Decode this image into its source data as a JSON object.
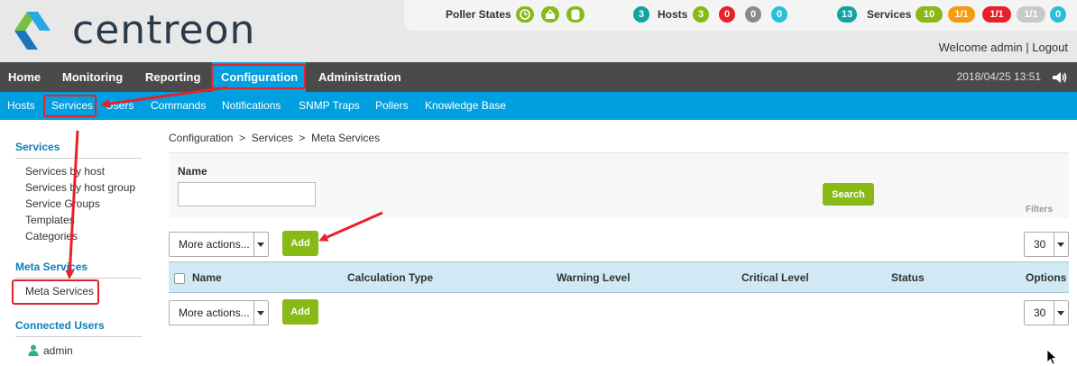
{
  "brand": {
    "name": "centreon"
  },
  "status_bar": {
    "poller_label": "Poller States",
    "hosts_count": "3",
    "hosts_label": "Hosts",
    "hosts_states": [
      "3",
      "0",
      "0",
      "0"
    ],
    "services_count": "13",
    "services_label": "Services",
    "services_states": [
      "10",
      "1/1",
      "1/1",
      "1/1",
      "0"
    ]
  },
  "user": {
    "welcome": "Welcome admin",
    "separator": "|",
    "logout": "Logout"
  },
  "main_nav": [
    "Home",
    "Monitoring",
    "Reporting",
    "Configuration",
    "Administration"
  ],
  "datetime": "2018/04/25 13:51",
  "sub_nav": [
    "Hosts",
    "Services",
    "Users",
    "Commands",
    "Notifications",
    "SNMP Traps",
    "Pollers",
    "Knowledge Base"
  ],
  "sidebar": {
    "services_title": "Services",
    "services_items": [
      "Services by host",
      "Services by host group",
      "Service Groups",
      "Templates",
      "Categories"
    ],
    "meta_title": "Meta Services",
    "meta_items": [
      "Meta Services"
    ],
    "connected_title": "Connected Users",
    "connected_users": [
      "admin"
    ]
  },
  "breadcrumb": "Configuration  >  Services  >  Meta Services",
  "filter": {
    "name_label": "Name",
    "name_value": "",
    "search_label": "Search",
    "filters_label": "Filters"
  },
  "toolbar": {
    "more_actions": "More actions...",
    "add_label": "Add",
    "page_size": "30"
  },
  "table": {
    "columns": [
      "Name",
      "Calculation Type",
      "Warning Level",
      "Critical Level",
      "Status",
      "Options"
    ]
  },
  "colors": {
    "accent": "#009fdf",
    "nav_dark": "#4a4a4a",
    "green": "#88b917",
    "red": "#e8202a",
    "orange": "#f39c12",
    "grey": "#8a8a8a",
    "cyan": "#29c0d6",
    "teal": "#10a5a0"
  }
}
